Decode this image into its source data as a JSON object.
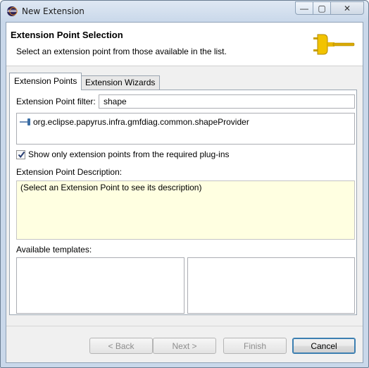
{
  "window": {
    "title": "New Extension",
    "controls": {
      "minimize": "—",
      "maximize": "▢",
      "close": "✕"
    }
  },
  "header": {
    "title": "Extension Point Selection",
    "subtitle": "Select an extension point from those available in the list.",
    "icon": "plug-icon"
  },
  "tabs": [
    {
      "label": "Extension Points",
      "active": true
    },
    {
      "label": "Extension Wizards",
      "active": false
    }
  ],
  "filter": {
    "label": "Extension Point filter:",
    "value": "shape"
  },
  "extension_points": [
    {
      "label": "org.eclipse.papyrus.infra.gmfdiag.common.shapeProvider",
      "icon": "extension-point-icon"
    }
  ],
  "show_required_only": {
    "label": "Show only extension points from the required plug-ins",
    "checked": true
  },
  "description": {
    "label": "Extension Point Description:",
    "text": "(Select an Extension Point to see its description)"
  },
  "templates": {
    "label": "Available templates:"
  },
  "buttons": {
    "back": "< Back",
    "next": "Next >",
    "finish": "Finish",
    "cancel": "Cancel"
  },
  "colors": {
    "description_background": "#ffffe1",
    "default_button_border": "#3c7fb1",
    "titlebar": "#c9d8ea"
  }
}
